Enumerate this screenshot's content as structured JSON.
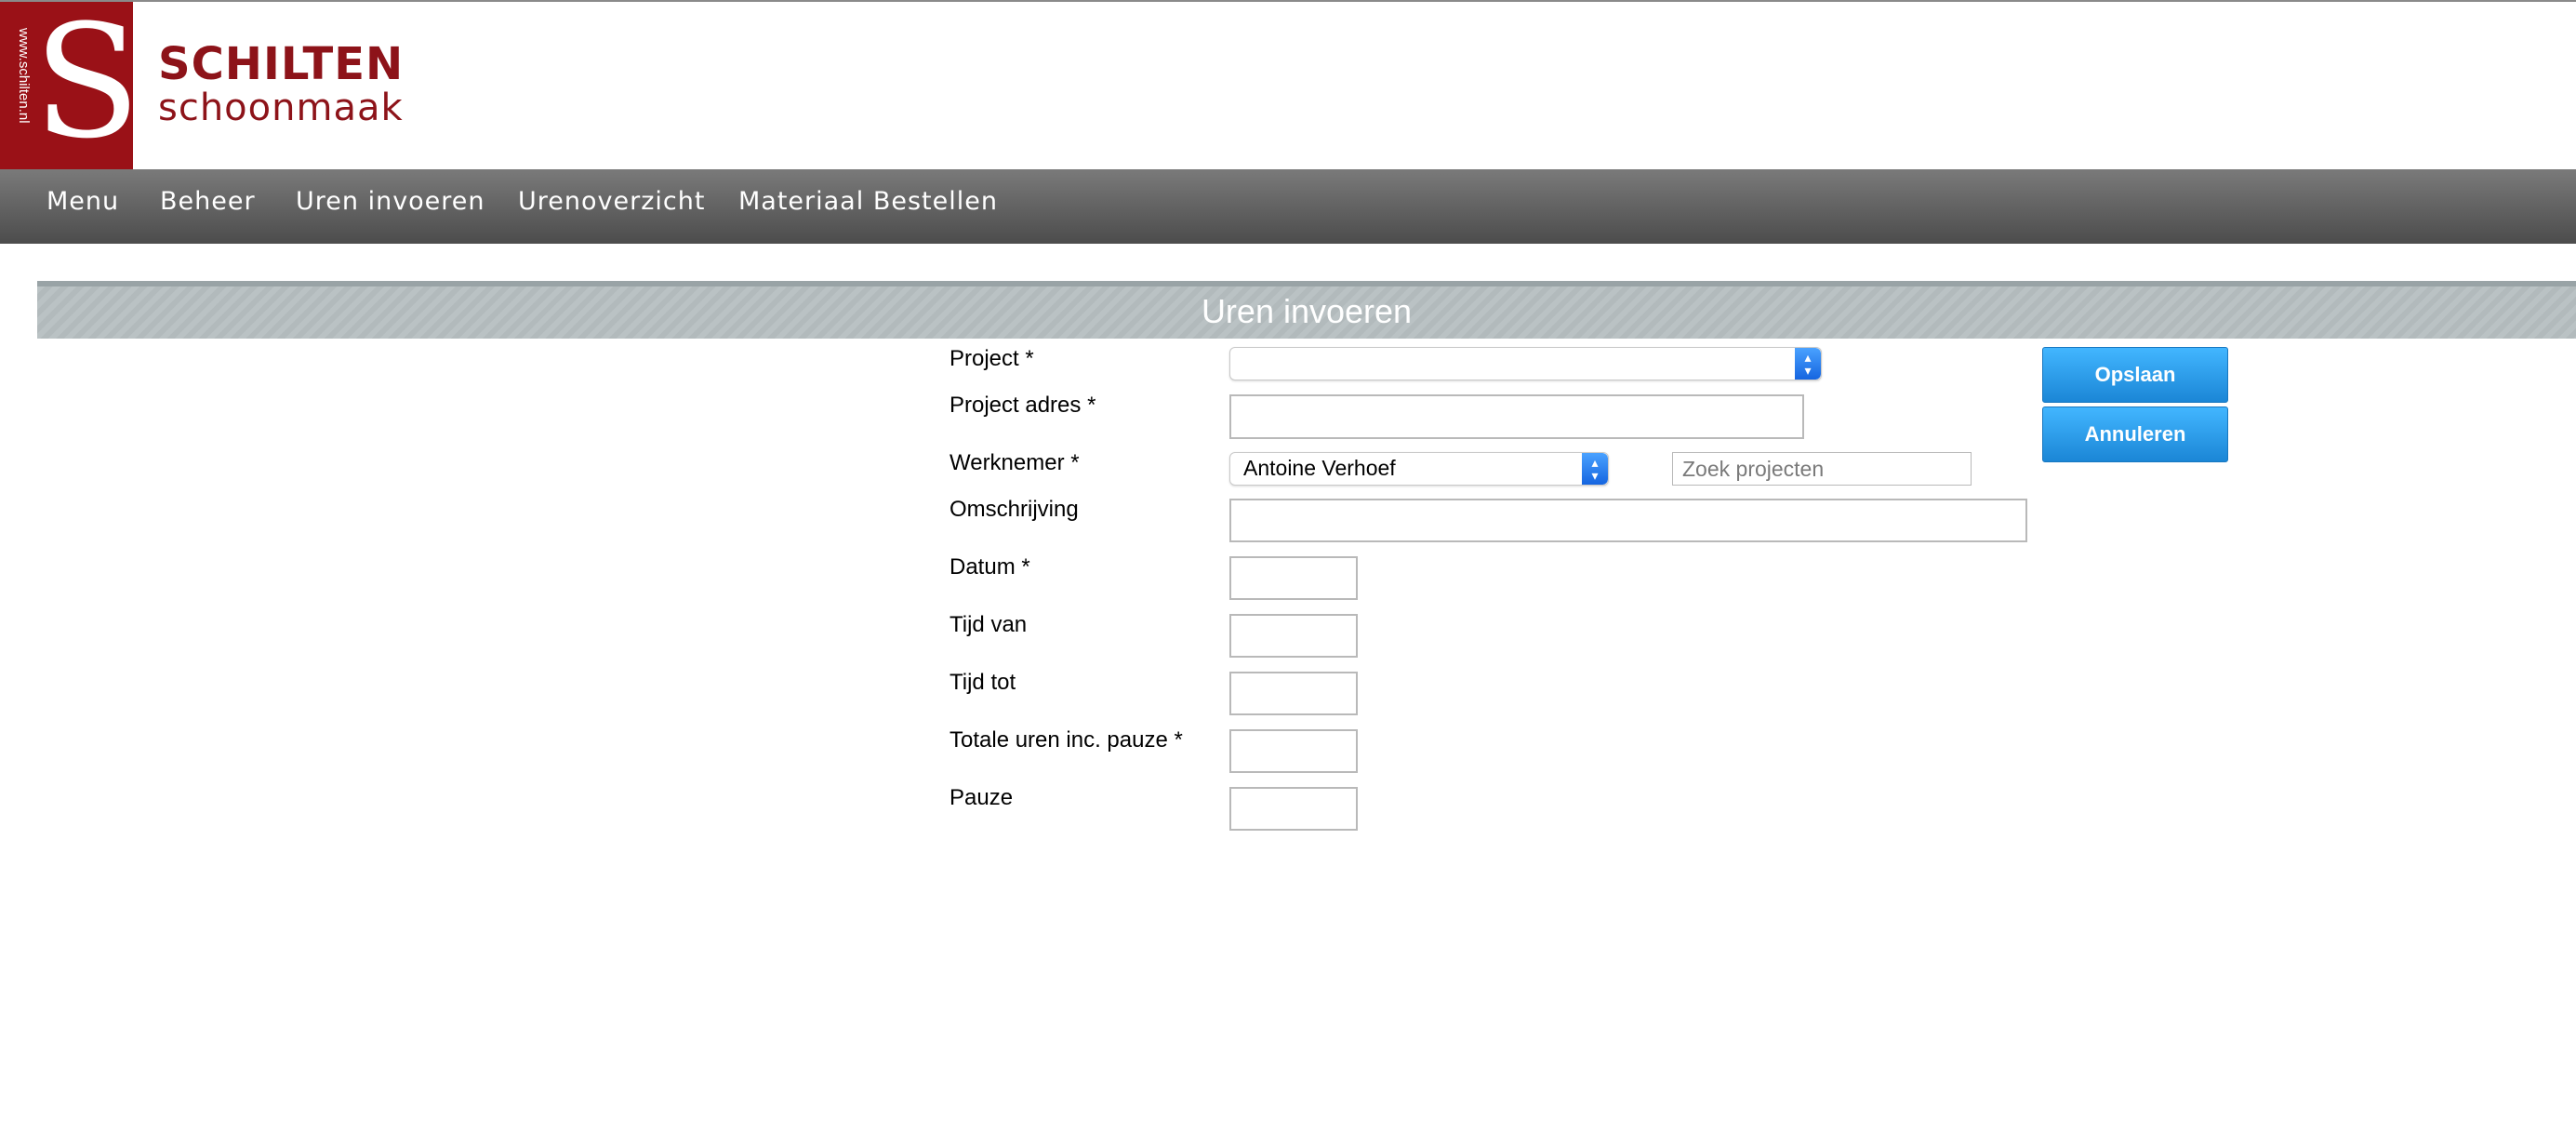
{
  "brand": {
    "url_text": "www.schilten.nl",
    "logo_letter": "S",
    "name": "SCHILTEN",
    "subtitle": "schoonmaak"
  },
  "nav": {
    "items": [
      {
        "label": "Menu"
      },
      {
        "label": "Beheer"
      },
      {
        "label": "Uren invoeren"
      },
      {
        "label": "Urenoverzicht"
      },
      {
        "label": "Materiaal Bestellen"
      }
    ]
  },
  "page": {
    "section_title": "Uren invoeren"
  },
  "form": {
    "project": {
      "label": "Project *",
      "value": ""
    },
    "project_adres": {
      "label": "Project adres *",
      "value": ""
    },
    "werknemer": {
      "label": "Werknemer *",
      "value": "Antoine Verhoef"
    },
    "zoek_projecten": {
      "placeholder": "Zoek projecten",
      "value": ""
    },
    "omschrijving": {
      "label": "Omschrijving",
      "value": ""
    },
    "datum": {
      "label": "Datum *",
      "value": ""
    },
    "tijd_van": {
      "label": "Tijd van",
      "value": ""
    },
    "tijd_tot": {
      "label": "Tijd tot",
      "value": ""
    },
    "totale_uren": {
      "label": "Totale uren inc. pauze *",
      "value": ""
    },
    "pauze": {
      "label": "Pauze",
      "value": ""
    }
  },
  "actions": {
    "save_label": "Opslaan",
    "cancel_label": "Annuleren"
  },
  "colors": {
    "brand_red": "#9a1117",
    "button_blue": "#1b86d6",
    "nav_gray": "#5c5c5c"
  }
}
